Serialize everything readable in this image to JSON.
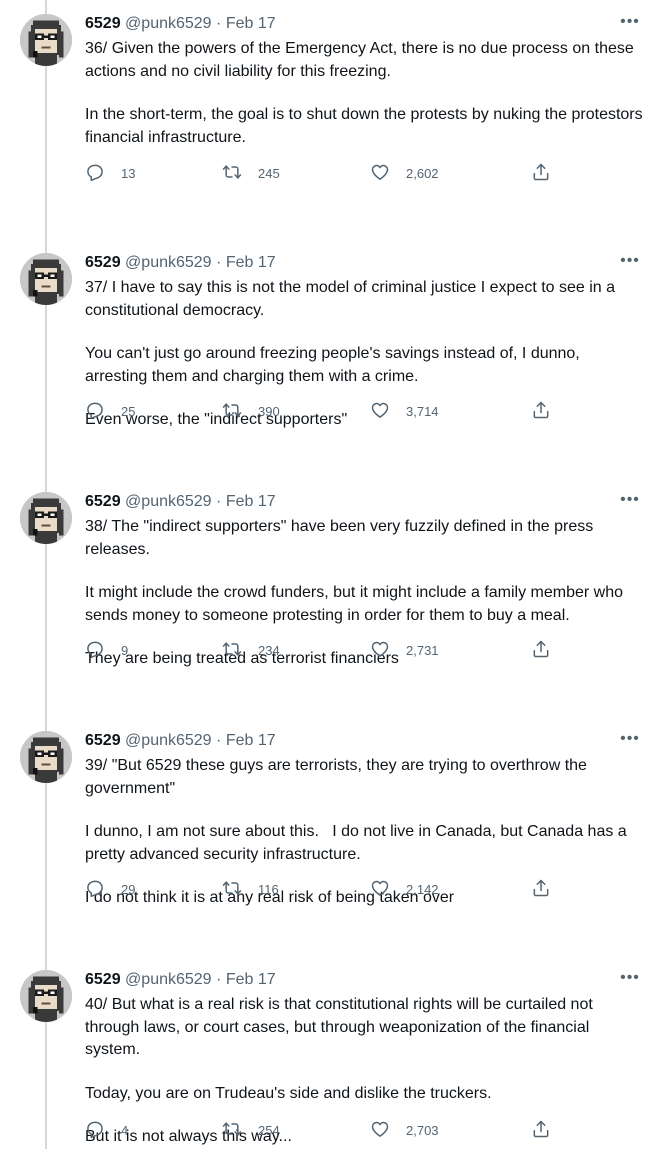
{
  "author": {
    "name": "6529",
    "handle": "@punk6529",
    "separator": "·"
  },
  "tweets": [
    {
      "date": "Feb 17",
      "paragraphs": [
        "36/ Given the powers of the Emergency Act, there is no due process on these actions and no civil liability for this freezing.",
        "In the short-term, the goal is to shut down the protests by nuking the protestors financial infrastructure."
      ],
      "replies": "13",
      "retweets": "245",
      "likes": "2,602"
    },
    {
      "date": "Feb 17",
      "paragraphs": [
        "37/ I have to say this is not the model of criminal justice I expect to see in a constitutional democracy.",
        "You can't just go around freezing people's savings instead of, I dunno, arresting them and charging them with a crime.",
        "Even worse, the \"indirect supporters\""
      ],
      "replies": "25",
      "retweets": "390",
      "likes": "3,714"
    },
    {
      "date": "Feb 17",
      "paragraphs": [
        "38/ The \"indirect supporters\" have been very fuzzily defined in the press releases.",
        "It might include the crowd funders, but it might include a family member who sends money to someone protesting in order for them to buy a meal.",
        "They are being treated as terrorist financiers"
      ],
      "replies": "9",
      "retweets": "234",
      "likes": "2,731"
    },
    {
      "date": "Feb 17",
      "paragraphs": [
        "39/ \"But 6529 these guys are terrorists, they are trying to overthrow the government\"",
        "I dunno, I am not sure about this.   I do not live in Canada, but Canada has a pretty advanced security infrastructure.",
        "I do not think it is at any real risk of being taken over"
      ],
      "replies": "29",
      "retweets": "116",
      "likes": "2,142"
    },
    {
      "date": "Feb 17",
      "paragraphs": [
        "40/ But what is a real risk is that constitutional rights will be curtailed not through laws, or court cases, but through weaponization of the financial system.",
        "Today, you are on Trudeau's side and dislike the truckers.",
        "But it is not always this way..."
      ],
      "replies": "4",
      "retweets": "254",
      "likes": "2,703"
    }
  ],
  "icons": {
    "reply": "reply-icon",
    "retweet": "retweet-icon",
    "like": "heart-icon",
    "share": "share-icon",
    "more": "more-icon"
  },
  "colors": {
    "text": "#0f1419",
    "secondary": "#536471",
    "thread_line": "#cfd9de"
  }
}
